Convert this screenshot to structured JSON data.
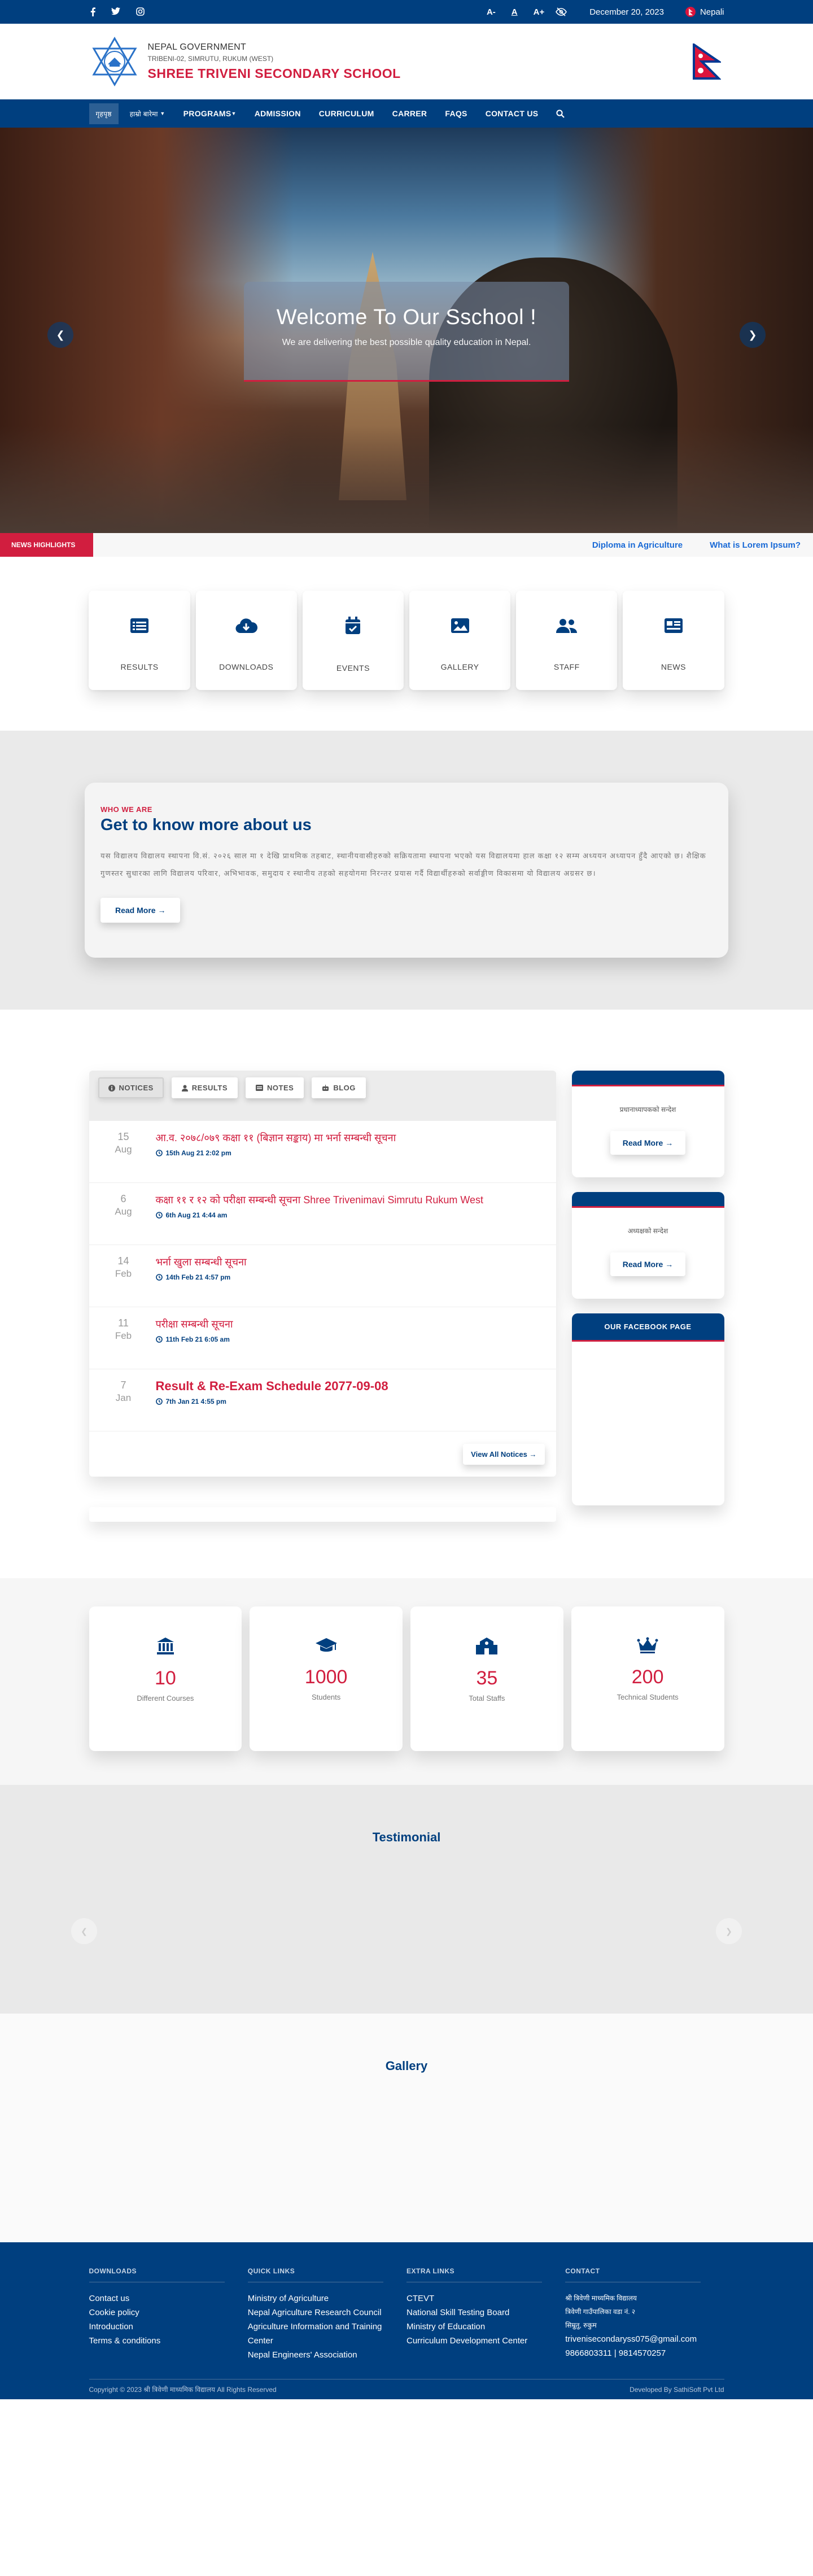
{
  "topbar": {
    "social": [
      "facebook-icon",
      "twitter-icon",
      "instagram-icon"
    ],
    "font_small": "A-",
    "font_normal": "A",
    "font_large": "A+",
    "date": "December 20, 2023",
    "language": "Nepali"
  },
  "header": {
    "gov": "NEPAL GOVERNMENT",
    "address": "TRIBENI-02, SIMRUTU, RUKUM (WEST)",
    "school": "SHREE TRIVENI SECONDARY SCHOOL"
  },
  "nav": {
    "items": [
      {
        "label": "गृहपृष्ठ",
        "active": true
      },
      {
        "label": "हाम्रो बारेमा",
        "dropdown": true
      },
      {
        "label": "PROGRAMS",
        "dropdown": true
      },
      {
        "label": "ADMISSION"
      },
      {
        "label": "CURRICULUM"
      },
      {
        "label": "CARRER"
      },
      {
        "label": "FAQS"
      },
      {
        "label": "CONTACT US"
      }
    ]
  },
  "hero": {
    "title": "Welcome To Our Sschool !",
    "subtitle": "We are delivering the best possible quality education in Nepal."
  },
  "news": {
    "label": "NEWS HIGHLIGHTS",
    "items": [
      "Diploma in Agriculture",
      "What is Lorem Ipsum?"
    ]
  },
  "quick_links": [
    {
      "label": "RESULTS",
      "icon": "list-icon"
    },
    {
      "label": "DOWNLOADS",
      "icon": "cloud-download-icon"
    },
    {
      "label": "EVENTS",
      "icon": "calendar-check-icon"
    },
    {
      "label": "GALLERY",
      "icon": "image-icon"
    },
    {
      "label": "STAFF",
      "icon": "users-icon"
    },
    {
      "label": "NEWS",
      "icon": "newspaper-icon"
    }
  ],
  "about": {
    "sub": "WHO WE ARE",
    "title": "Get to know more about us",
    "text": "यस विद्यालय विद्यालय स्थापना वि.सं. २०२६ साल मा १ देखि प्राथमिक तहबाट, स्थानीयवासीहरुको सक्रियतामा स्थापना भएको यस विद्यालयमा हाल कक्षा १२ सम्म अध्ययन अध्यापन हुँदै आएको छ। शैक्षिक गुणस्तर सुधारका लागि विद्यालय परिवार, अभिभावक, समुदाय र स्थानीय तहको सहयोगमा निरन्तर प्रयास गर्दै विद्यार्थीहरुको सर्वाङ्गीण विकासमा यो विद्यालय अग्रसर छ।",
    "button": "Read More →"
  },
  "notices": {
    "tabs": [
      {
        "label": "NOTICES",
        "icon": "info-icon",
        "active": true
      },
      {
        "label": "RESULTS",
        "icon": "user-icon"
      },
      {
        "label": "NOTES",
        "icon": "note-icon"
      },
      {
        "label": "BLOG",
        "icon": "blog-icon"
      }
    ],
    "items": [
      {
        "day": "15",
        "month": "Aug",
        "title": "आ.व. २०७८/०७९ कक्षा ११ (बिज्ञान सङ्काय) मा भर्ना सम्बन्धी सूचना",
        "meta": "15th Aug 21 2:02 pm",
        "big": false
      },
      {
        "day": "6",
        "month": "Aug",
        "title": "कक्षा ११ र १२ को परीक्षा सम्बन्धी सूचना Shree Trivenimavi Simrutu Rukum West",
        "meta": "6th Aug 21 4:44 am",
        "big": false
      },
      {
        "day": "14",
        "month": "Feb",
        "title": "भर्ना खुला सम्बन्धी सूचना",
        "meta": "14th Feb 21 4:57 pm",
        "big": false
      },
      {
        "day": "11",
        "month": "Feb",
        "title": "परीक्षा सम्बन्धी सूचना",
        "meta": "11th Feb 21 6:05 am",
        "big": false
      },
      {
        "day": "7",
        "month": "Jan",
        "title": "Result & Re-Exam Schedule 2077-09-08",
        "meta": "7th Jan 21 4:55 pm",
        "big": true
      }
    ],
    "view_all": "View All Notices →"
  },
  "sidebar": [
    {
      "text": "प्रधानाध्यापकको सन्देश",
      "button": "Read More →"
    },
    {
      "text": "अध्यक्षको सन्देश",
      "button": "Read More →"
    },
    {
      "title": "OUR FACEBOOK PAGE"
    }
  ],
  "counters": [
    {
      "value": "10",
      "label": "Different Courses",
      "icon": "bank-icon"
    },
    {
      "value": "1000",
      "label": "Students",
      "icon": "graduation-cap-icon"
    },
    {
      "value": "35",
      "label": "Total Staffs",
      "icon": "school-icon"
    },
    {
      "value": "200",
      "label": "Technical Students",
      "icon": "crown-icon"
    }
  ],
  "testimonial": {
    "title": "Testimonial"
  },
  "gallery": {
    "title": "Gallery"
  },
  "footer": {
    "cols": [
      {
        "title": "DOWNLOADS",
        "items": [
          "Contact us",
          "Cookie policy",
          "Introduction",
          "Terms & conditions"
        ]
      },
      {
        "title": "QUICK LINKS",
        "items": [
          "Ministry of Agriculture",
          "Nepal Agriculture Research Council",
          "Agriculture Information and Training Center",
          "Nepal Engineers' Association"
        ]
      },
      {
        "title": "EXTRA LINKS",
        "items": [
          "CTEVT",
          "National Skill Testing Board",
          "Ministry of Education",
          "Curriculum Development Center"
        ]
      },
      {
        "title": "CONTACT",
        "items": [
          "श्री त्रिवेणी माध्यमिक विद्यालय",
          "त्रिवेणी गाउँपालिका वडा नं. २",
          "सिम्रुतु, रुकुम",
          "trivenisecondaryss075@gmail.com",
          "9866803311 | 9814570257"
        ]
      }
    ],
    "copyright": "Copyright © 2023 श्री त्रिवेणी माध्यमिक विद्यालय All Rights Reserved",
    "developer": "Developed By SathiSoft Pvt Ltd"
  },
  "colors": {
    "brand": "#003f7f",
    "accent": "#d11e3f"
  }
}
